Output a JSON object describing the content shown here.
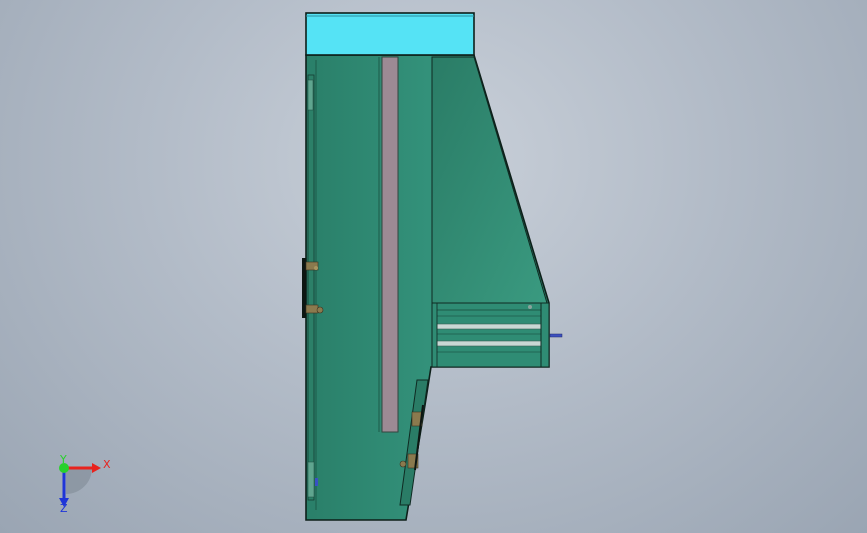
{
  "viewport": {
    "background_top": "#c9d0d9",
    "background_bottom": "#9aa5b3"
  },
  "model": {
    "body_color": "#2e8a72",
    "top_cover_color": "#55e3f5",
    "slot_color": "#9c8a94",
    "edge_color": "#0d1f19"
  },
  "triad": {
    "x_label": "X",
    "y_label": "Y",
    "z_label": "Z",
    "x_color": "#e8231e",
    "y_color": "#28d12b",
    "z_color": "#1f35d8"
  }
}
